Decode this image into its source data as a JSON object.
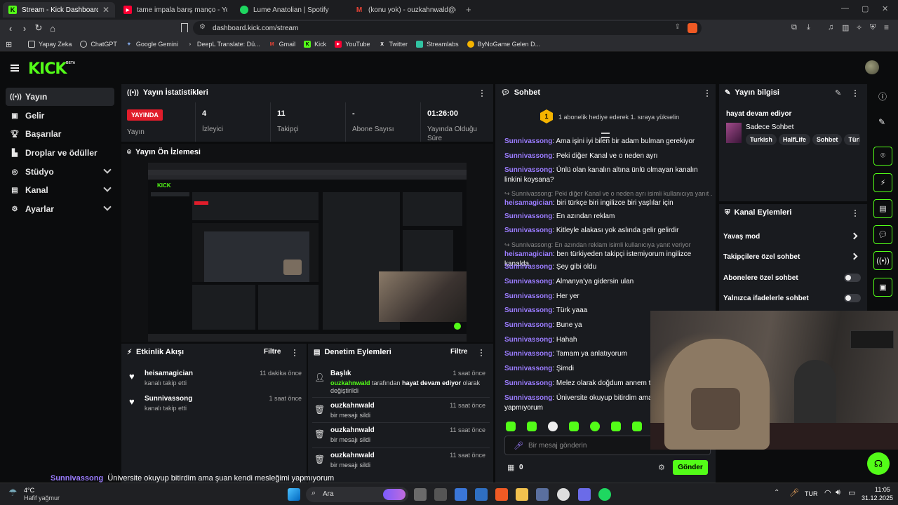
{
  "browser": {
    "tabs": [
      {
        "title": "Stream - Kick Dashboard",
        "active": true
      },
      {
        "title": "tame impala barış manço - YouTube",
        "active": false
      },
      {
        "title": "Lume Anatolian | Spotify",
        "active": false
      },
      {
        "title": "(konu yok) - ouzkahnwald@gmail.co",
        "active": false
      }
    ],
    "url": "dashboard.kick.com/stream",
    "bookmarks": [
      "Yapay Zeka",
      "ChatGPT",
      "Google Gemini",
      "DeepL Translate: Dü...",
      "Gmail",
      "Kick",
      "YouTube",
      "Twitter",
      "Streamlabs",
      "ByNoGame Gelen D..."
    ]
  },
  "app": {
    "logo": "KICK",
    "beta": "BETA"
  },
  "sidebar": {
    "items": [
      {
        "label": "Yayın",
        "icon": "broadcast-icon",
        "active": true
      },
      {
        "label": "Gelir",
        "icon": "wallet-icon"
      },
      {
        "label": "Başarılar",
        "icon": "trophy-icon"
      },
      {
        "label": "Droplar ve ödüller",
        "icon": "gift-icon"
      },
      {
        "label": "Stüdyo",
        "icon": "studio-icon",
        "expandable": true
      },
      {
        "label": "Kanal",
        "icon": "channel-icon",
        "expandable": true
      },
      {
        "label": "Ayarlar",
        "icon": "gear-icon",
        "expandable": true
      }
    ]
  },
  "stats": {
    "title": "Yayın İstatistikleri",
    "live_badge": "YAYINDA",
    "items": [
      {
        "value": "",
        "label": "Yayın"
      },
      {
        "value": "4",
        "label": "İzleyici"
      },
      {
        "value": "11",
        "label": "Takipçi"
      },
      {
        "value": "-",
        "label": "Abone Sayısı"
      },
      {
        "value": "01:26:00",
        "label": "Yayında Olduğu Süre"
      }
    ]
  },
  "preview": {
    "title": "Yayın Ön İzlemesi"
  },
  "activity": {
    "title": "Etkinlik Akışı",
    "filter": "Filtre",
    "items": [
      {
        "user": "heisamagician",
        "desc": "kanalı takip etti",
        "time": "11 dakika önce"
      },
      {
        "user": "Sunnivassong",
        "desc": "kanalı takip etti",
        "time": "1 saat önce"
      }
    ]
  },
  "moderation": {
    "title": "Denetim Eylemleri",
    "filter": "Filtre",
    "first": {
      "name": "Başlık",
      "time": "1 saat önce",
      "user": "ouzkahnwald",
      "mid": "tarafından",
      "value": "hayat devam ediyor",
      "tail": "olarak",
      "line2": "değiştirildi"
    },
    "items": [
      {
        "name": "ouzkahnwald",
        "desc": "bir mesajı sildi",
        "time": "11 saat önce"
      },
      {
        "name": "ouzkahnwald",
        "desc": "bir mesajı sildi",
        "time": "11 saat önce"
      },
      {
        "name": "ouzkahnwald",
        "desc": "bir mesajı sildi",
        "time": "11 saat önce"
      }
    ]
  },
  "chat": {
    "title": "Sohbet",
    "gift_badge": "1",
    "gift_text": "1 abonelik hediye ederek 1. sıraya yükselin",
    "messages": [
      {
        "user": "Sunnivassong",
        "text": "Ama işini iyi bilen bir adam bulman gerekiyor"
      },
      {
        "user": "Sunnivassong",
        "text": "Peki diğer Kanal ve o neden ayrı"
      },
      {
        "user": "Sunnivassong",
        "text": "Ünlü olan kanalın altına ünlü olmayan kanalın linkini koysana?"
      },
      {
        "reply": "Sunnivassong: Peki diğer Kanal ve o neden ayrı isimli kullanıcıya yanıt ...",
        "user": "heisamagician",
        "text": "biri türkçe biri ingilizce biri yaşlılar için"
      },
      {
        "user": "Sunnivassong",
        "text": "En azından reklam"
      },
      {
        "user": "Sunnivassong",
        "text": "Kitleyle alakası yok aslında gelir gelirdir"
      },
      {
        "reply": "Sunnivassong: En azından reklam isimli kullanıcıya yanıt veriyor",
        "user": "heisamagician",
        "text": "ben türkiyeden takipçi istemiyorum ingilizce kanalda"
      },
      {
        "user": "Sunnivassong",
        "text": "Şey gibi oldu"
      },
      {
        "user": "Sunnivassong",
        "text": "Almanya'ya gidersin ulan"
      },
      {
        "user": "Sunnivassong",
        "text": "Her yer"
      },
      {
        "user": "Sunnivassong",
        "text": "Türk yaaa"
      },
      {
        "user": "Sunnivassong",
        "text": "Bune ya"
      },
      {
        "user": "Sunnivassong",
        "text": "Hahah"
      },
      {
        "user": "Sunnivassong",
        "text": "Tamam ya anlatıyorum"
      },
      {
        "user": "Sunnivassong",
        "text": "Şimdi"
      },
      {
        "user": "Sunnivassong",
        "text": "Melez olarak doğdum annem türk b"
      },
      {
        "user": "Sunnivassong",
        "text": "Üniversite okuyup bitirdim ama şua",
        "line2": "yapmıyorum"
      }
    ],
    "input_placeholder": "Bir mesaj gönderin",
    "points": "0",
    "send": "Gönder"
  },
  "stream_info": {
    "title": "Yayın bilgisi",
    "stream_title": "hayat devam ediyor",
    "category": "Sadece Sohbet",
    "tags": [
      "Turkish",
      "HalfLife",
      "Sohbet",
      "Türkç"
    ]
  },
  "channel_actions": {
    "title": "Kanal Eylemleri",
    "items": [
      {
        "label": "Yavaş mod",
        "type": "arrow"
      },
      {
        "label": "Takipçilere özel sohbet",
        "type": "arrow"
      },
      {
        "label": "Abonelere özel sohbet",
        "type": "toggle"
      },
      {
        "label": "Yalnızca ifadelerle sohbet",
        "type": "toggle"
      }
    ]
  },
  "overlay": {
    "user": "Sunnivassong",
    "text": "Üniversite okuyup bitirdim ama şuan kendi mesleğimi yapmıyorum"
  },
  "taskbar": {
    "weather_temp": "4°C",
    "weather_desc": "Hafif yağmur",
    "search": "Ara",
    "lang": "TUR",
    "time": "11:05",
    "date": "31.12.2025"
  },
  "colors": {
    "accent": "#53fc18",
    "username": "#9b7cff",
    "live": "#e11d2b"
  }
}
